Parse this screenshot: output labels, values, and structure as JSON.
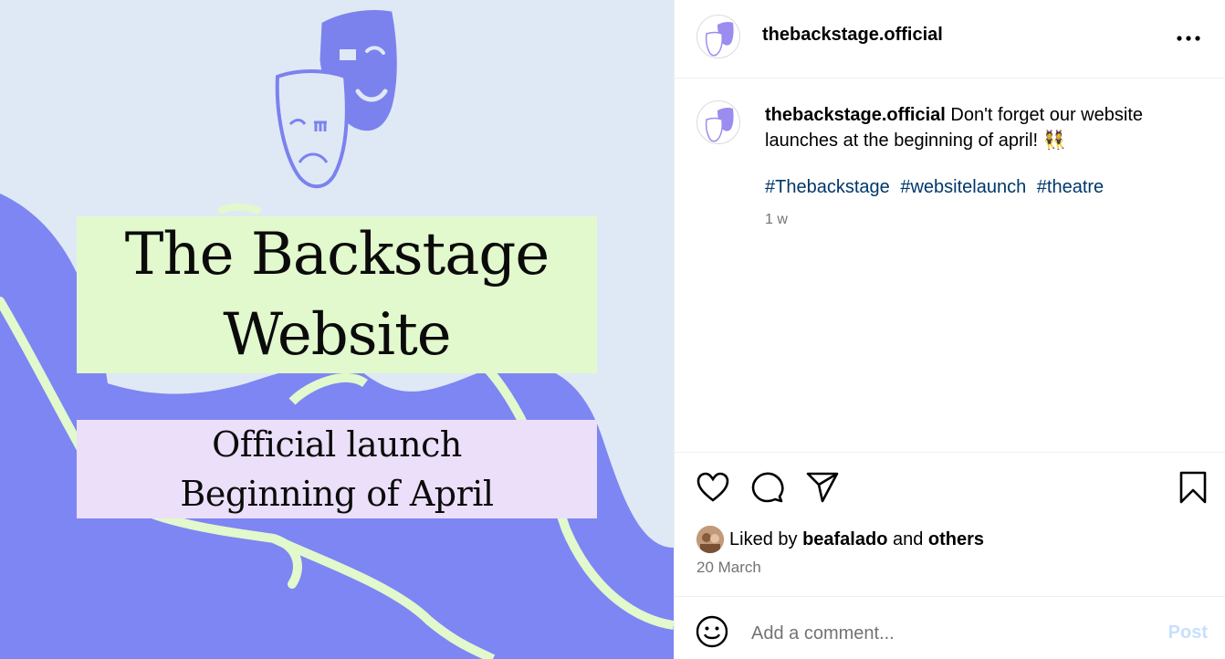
{
  "post_image": {
    "title_lines": [
      "The Backstage",
      "Website"
    ],
    "subtitle_lines": [
      "Official launch",
      "Beginning of April"
    ]
  },
  "header": {
    "username": "thebackstage.official",
    "avatar_icon": "theatre-masks-icon",
    "more_icon": "more-options-icon"
  },
  "caption": {
    "username": "thebackstage.official",
    "text": " Don't forget our website launches at the beginning of april! 👯",
    "hashtags": [
      "#Thebackstage",
      "#websitelaunch",
      "#theatre"
    ],
    "time_ago": "1 w"
  },
  "actions": {
    "icons": [
      "heart-icon",
      "comment-icon",
      "share-icon",
      "bookmark-icon"
    ],
    "liked_prefix": "Liked by ",
    "liked_user": "beafalado",
    "liked_and": " and ",
    "liked_others": "others",
    "date": "20 March"
  },
  "comment": {
    "placeholder": "Add a comment...",
    "post_label": "Post"
  },
  "colors": {
    "accent_purple": "#7d86f2",
    "mask_purple": "#7b82ee",
    "light_green": "#e2f8cd",
    "light_lilac": "#ecdff9",
    "background_blue": "#dfe9f5",
    "hashtag_blue": "#00376b",
    "post_button_disabled": "#c7e0fd"
  }
}
